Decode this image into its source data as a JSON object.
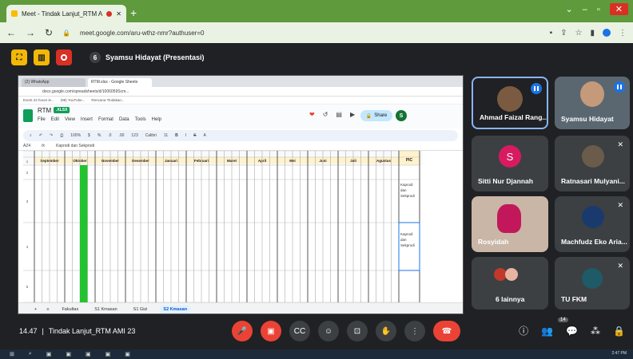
{
  "browser": {
    "tab_title": "Meet - Tindak Lanjut_RTM A",
    "url": "meet.google.com/aru-wthz-nmr?authuser=0"
  },
  "presenter": {
    "avatar_letter": "6",
    "label": "Syamsu Hidayat (Presentasi)"
  },
  "shared_screen": {
    "tabs": [
      "(2) WhatsApp",
      "RTM.xlsx - Google Sheets"
    ],
    "url": "docs.google.com/spreadsheets/d/1006059Scm...",
    "bookmarks": [
      "Event 24 hours le...",
      "(98) YouTube...",
      "Rencana Tindakan..."
    ],
    "doc_title": "RTM",
    "doc_badge": ".XLSX",
    "menu": [
      "File",
      "Edit",
      "View",
      "Insert",
      "Format",
      "Data",
      "Tools",
      "Help"
    ],
    "share_label": "Share",
    "avatar_letter": "S",
    "toolbar_text": [
      "100%",
      "$",
      "%",
      ".0",
      ".00",
      "123",
      "Calibri",
      "11",
      "B",
      "I",
      "S",
      "A"
    ],
    "cell_ref": "AZ4",
    "formula": "Kaprodi dan Sekprodi",
    "months": [
      "September",
      "Oktober",
      "November",
      "Desember",
      "Januari",
      "Februari",
      "Maret",
      "April",
      "Mei",
      "Juni",
      "Juli",
      "Agustus"
    ],
    "pic_header": "PIC",
    "row_numbers": [
      "1",
      "2",
      "3",
      "4",
      "5"
    ],
    "pic_cells": [
      "Kaprodi dan Sekprodi",
      "Kaprodi dan Sekprodi"
    ],
    "sheet_tabs": [
      "Fakultas",
      "S1 Kmasan",
      "S1 Gizi",
      "S2 Kmasan"
    ]
  },
  "participants": [
    {
      "name": "Ahmad Faizal Rang...",
      "speaking": true
    },
    {
      "name": "Syamsu Hidayat",
      "speaking": true
    },
    {
      "name": "Sitti Nur Djannah",
      "letter": "S",
      "color": "#d81b60"
    },
    {
      "name": "Ratnasari Mulyani...",
      "muted": true
    },
    {
      "name": "Rosyidah"
    },
    {
      "name": "Machfudz Eko Aria...",
      "muted": true
    },
    {
      "name": "6 lainnya"
    },
    {
      "name": "TU FKM",
      "muted": true
    }
  ],
  "meeting": {
    "time": "14.47",
    "separator": "|",
    "name": "Tindak Lanjut_RTM AMI 23",
    "participant_count": "14"
  },
  "taskbar": {
    "clock": "2:47 PM"
  }
}
